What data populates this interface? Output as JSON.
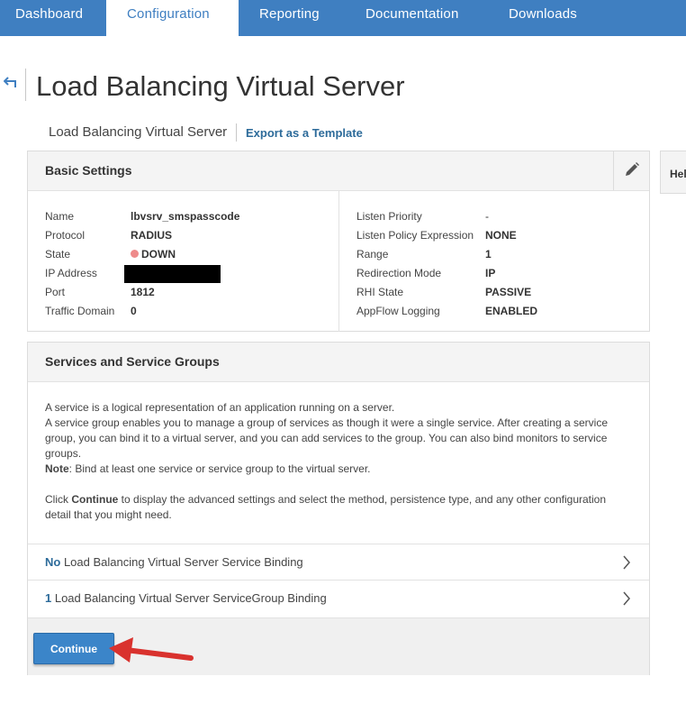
{
  "nav": {
    "tabs": [
      "Dashboard",
      "Configuration",
      "Reporting",
      "Documentation",
      "Downloads"
    ],
    "active": "Configuration"
  },
  "header": {
    "title": "Load Balancing Virtual Server",
    "breadcrumb": "Load Balancing Virtual Server",
    "export_link": "Export as a Template"
  },
  "help": {
    "label": "Hel"
  },
  "basic_settings": {
    "title": "Basic Settings",
    "left": [
      {
        "label": "Name",
        "value": "lbvsrv_smspasscode"
      },
      {
        "label": "Protocol",
        "value": "RADIUS"
      },
      {
        "label": "State",
        "value": "DOWN"
      },
      {
        "label": "IP Address",
        "value": ""
      },
      {
        "label": "Port",
        "value": "1812"
      },
      {
        "label": "Traffic Domain",
        "value": "0"
      }
    ],
    "right": [
      {
        "label": "Listen Priority",
        "value": "-"
      },
      {
        "label": "Listen Policy Expression",
        "value": "NONE"
      },
      {
        "label": "Range",
        "value": "1"
      },
      {
        "label": "Redirection Mode",
        "value": "IP"
      },
      {
        "label": "RHI State",
        "value": "PASSIVE"
      },
      {
        "label": "AppFlow Logging",
        "value": "ENABLED"
      }
    ]
  },
  "services": {
    "title": "Services and Service Groups",
    "desc1": "A service is a logical representation of an application running on a server.",
    "desc2": "A service group enables you to manage a group of services as though it were a single service. After creating a service group, you can bind it to a virtual server, and you can add services to the group. You can also bind monitors to service groups.",
    "note_label": "Note",
    "note_text": ": Bind at least one service or service group to the virtual server.",
    "click_pre": "Click ",
    "click_bold": "Continue",
    "click_post": " to display the advanced settings and select the method, persistence type, and any other configuration detail that you might need.",
    "bindings": [
      {
        "count": "No",
        "label": " Load Balancing Virtual Server Service Binding"
      },
      {
        "count": "1",
        "label": " Load Balancing Virtual Server ServiceGroup Binding"
      }
    ],
    "continue_label": "Continue"
  },
  "colors": {
    "nav": "#3f7fc1",
    "link": "#2d6b9a",
    "state_down": "#ee8a8a",
    "button": "#3b85c9",
    "arrow": "#d9322e"
  }
}
